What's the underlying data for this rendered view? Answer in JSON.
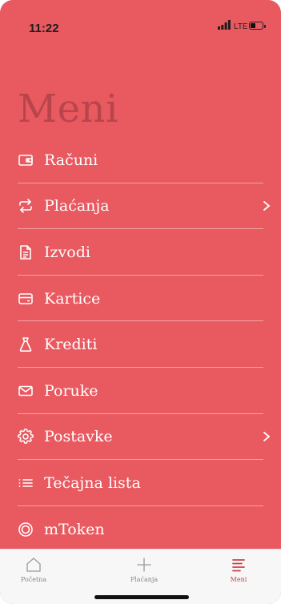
{
  "status_bar": {
    "time": "11:22",
    "network": "LTE"
  },
  "page": {
    "title": "Meni"
  },
  "menu": {
    "items": [
      {
        "label": "Računi",
        "icon": "wallet-icon",
        "chevron": false
      },
      {
        "label": "Plaćanja",
        "icon": "transfer-arrows-icon",
        "chevron": true
      },
      {
        "label": "Izvodi",
        "icon": "document-icon",
        "chevron": false
      },
      {
        "label": "Kartice",
        "icon": "card-icon",
        "chevron": false
      },
      {
        "label": "Krediti",
        "icon": "money-bag-icon",
        "chevron": false
      },
      {
        "label": "Poruke",
        "icon": "envelope-icon",
        "chevron": false
      },
      {
        "label": "Postavke",
        "icon": "gear-icon",
        "chevron": true
      },
      {
        "label": "Tečajna lista",
        "icon": "list-icon",
        "chevron": false
      },
      {
        "label": "mToken",
        "icon": "token-icon",
        "chevron": false
      }
    ]
  },
  "tabbar": {
    "tabs": [
      {
        "label": "Početna",
        "icon": "home-icon",
        "active": false
      },
      {
        "label": "Plaćanja",
        "icon": "plus-icon",
        "active": false
      },
      {
        "label": "Meni",
        "icon": "menu-icon",
        "active": true
      }
    ]
  },
  "colors": {
    "background": "#E85960",
    "title": "#B8454B",
    "active_tab": "#C8414A"
  }
}
